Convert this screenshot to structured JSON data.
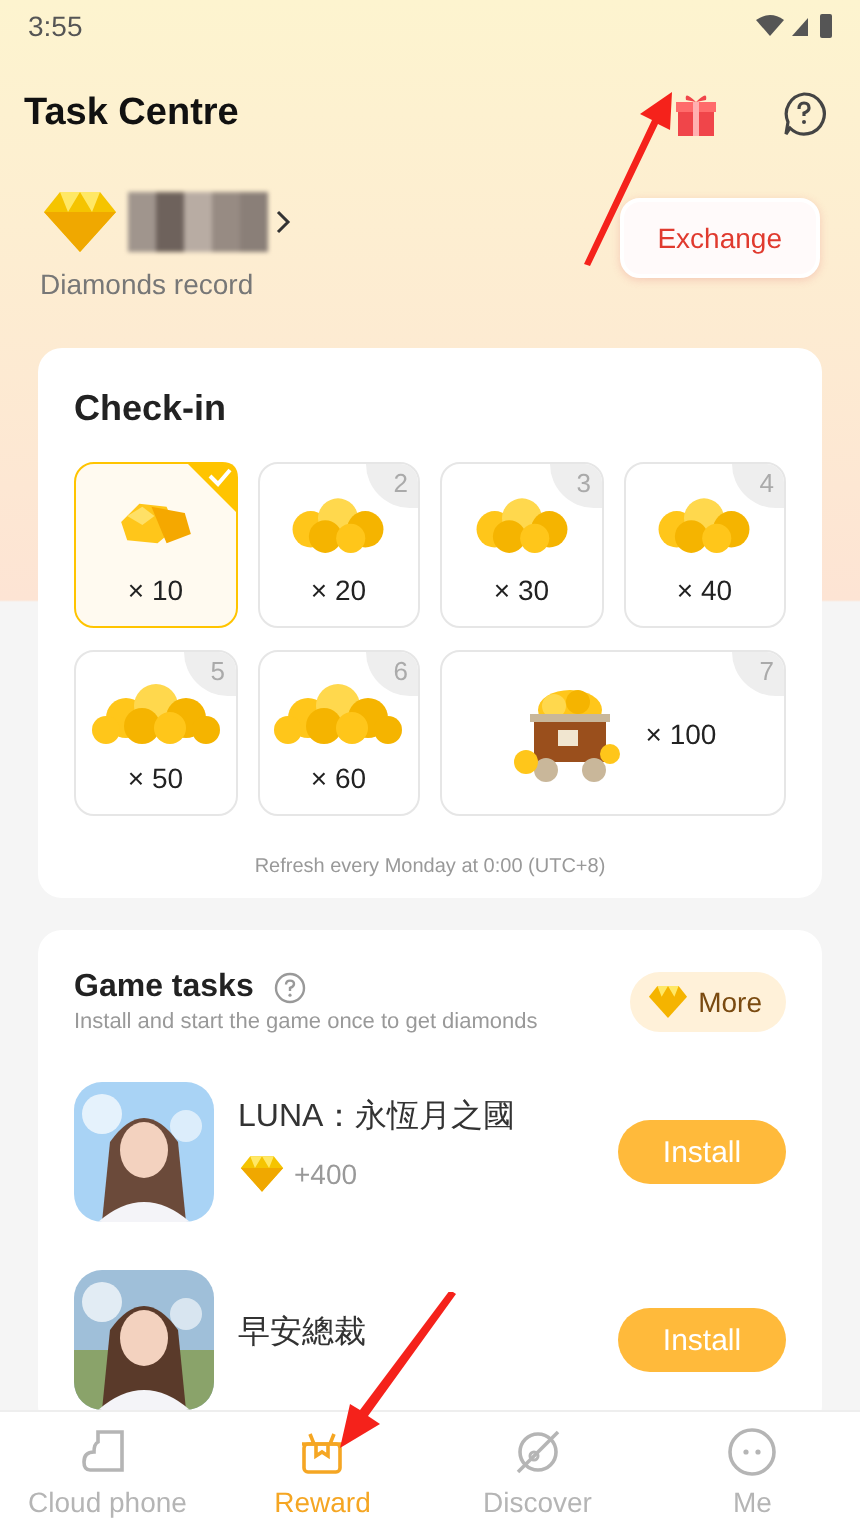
{
  "status_bar": {
    "time": "3:55"
  },
  "header": {
    "title": "Task Centre"
  },
  "account": {
    "label": "Diamonds record",
    "exchange": "Exchange"
  },
  "checkin": {
    "title": "Check-in",
    "note": "Refresh every Monday at 0:00 (UTC+8)",
    "days": [
      {
        "kind": "small",
        "amount": "× 10",
        "checked": true
      },
      {
        "kind": "medium",
        "number": "2",
        "amount": "× 20",
        "checked": false
      },
      {
        "kind": "medium",
        "number": "3",
        "amount": "× 30",
        "checked": false
      },
      {
        "kind": "medium",
        "number": "4",
        "amount": "× 40",
        "checked": false
      },
      {
        "kind": "large",
        "number": "5",
        "amount": "× 50",
        "checked": false
      },
      {
        "kind": "large",
        "number": "6",
        "amount": "× 60",
        "checked": false
      },
      {
        "kind": "cart",
        "number": "7",
        "amount": "× 100",
        "checked": false
      }
    ]
  },
  "game_tasks": {
    "title": "Game tasks",
    "subtitle": "Install and start the game once to get diamonds",
    "more": "More",
    "games": [
      {
        "name": "LUNA：永恆月之國",
        "reward": "+400",
        "action": "Install"
      },
      {
        "name": "早安總裁",
        "action": "Install"
      }
    ]
  },
  "nav": [
    {
      "label": "Cloud phone",
      "selected": false
    },
    {
      "label": "Reward",
      "selected": true
    },
    {
      "label": "Discover",
      "selected": false
    },
    {
      "label": "Me",
      "selected": false
    }
  ]
}
